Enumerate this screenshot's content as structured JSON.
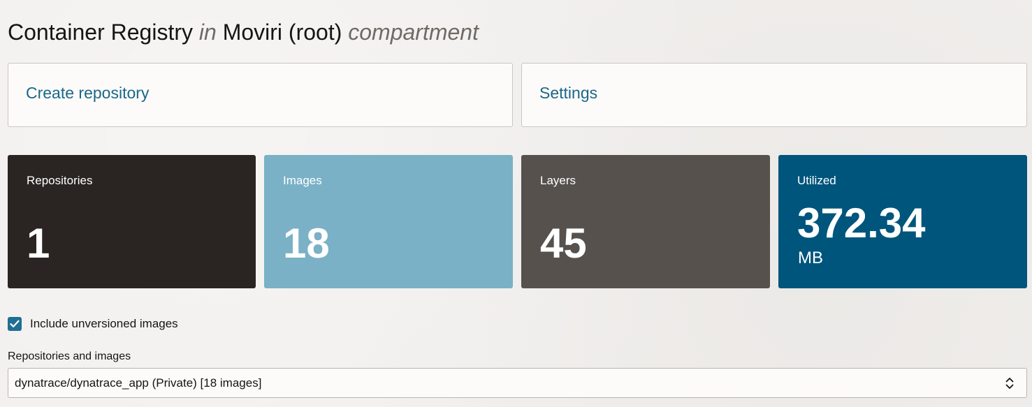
{
  "header": {
    "title_main": "Container Registry",
    "title_in": "in",
    "compartment_name": "Moviri (root)",
    "compartment_word": "compartment"
  },
  "actions": {
    "create_repository": "Create repository",
    "settings": "Settings"
  },
  "metrics": {
    "repositories": {
      "label": "Repositories",
      "value": "1"
    },
    "images": {
      "label": "Images",
      "value": "18"
    },
    "layers": {
      "label": "Layers",
      "value": "45"
    },
    "utilized": {
      "label": "Utilized",
      "value": "372.34",
      "unit": "MB"
    }
  },
  "filters": {
    "include_unversioned_label": "Include unversioned images",
    "include_unversioned_checked": true
  },
  "repository_select": {
    "label": "Repositories and images",
    "selected": "dynatrace/dynatrace_app (Private) [18 images]"
  },
  "colors": {
    "link": "#1b6789",
    "tile_repositories": "#2a2522",
    "tile_images": "#7ab1c6",
    "tile_layers": "#56514d",
    "tile_utilized": "#00557c",
    "checkbox": "#1f6f92"
  },
  "icons": {
    "checkbox_checked": "checkmark-icon",
    "select_chevron": "chevron-up-down-icon"
  }
}
